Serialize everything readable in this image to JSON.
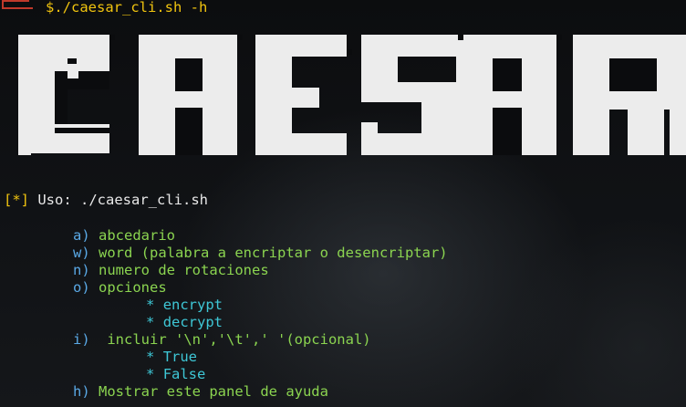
{
  "prompt": {
    "symbol": "$",
    "command": "./caesar_cli.sh",
    "args": "-h"
  },
  "banner": {
    "text": "CAESAR"
  },
  "usage": {
    "marker": "[*]",
    "text": "Uso: ./caesar_cli.sh"
  },
  "options": [
    {
      "flag": "a)",
      "desc": "abcedario"
    },
    {
      "flag": "w)",
      "desc": "word (palabra a encriptar o desencriptar)"
    },
    {
      "flag": "n)",
      "desc": "numero de rotaciones"
    },
    {
      "flag": "o)",
      "desc": "opciones"
    }
  ],
  "o_suboptions": [
    {
      "bullet": "*",
      "value": "encrypt"
    },
    {
      "bullet": "*",
      "value": "decrypt"
    }
  ],
  "option_i": {
    "flag": "i)",
    "desc": " incluir '\\n','\\t',' '(opcional)"
  },
  "i_suboptions": [
    {
      "bullet": "*",
      "value": "True"
    },
    {
      "bullet": "*",
      "value": "False"
    }
  ],
  "option_h": {
    "flag": "h)",
    "desc": "Mostrar este panel de ayuda"
  },
  "colors": {
    "prompt": "#f1c40f",
    "flag": "#5aa9e6",
    "description": "#8bd450",
    "suboption": "#3ec7d6",
    "banner": "#ececec"
  }
}
